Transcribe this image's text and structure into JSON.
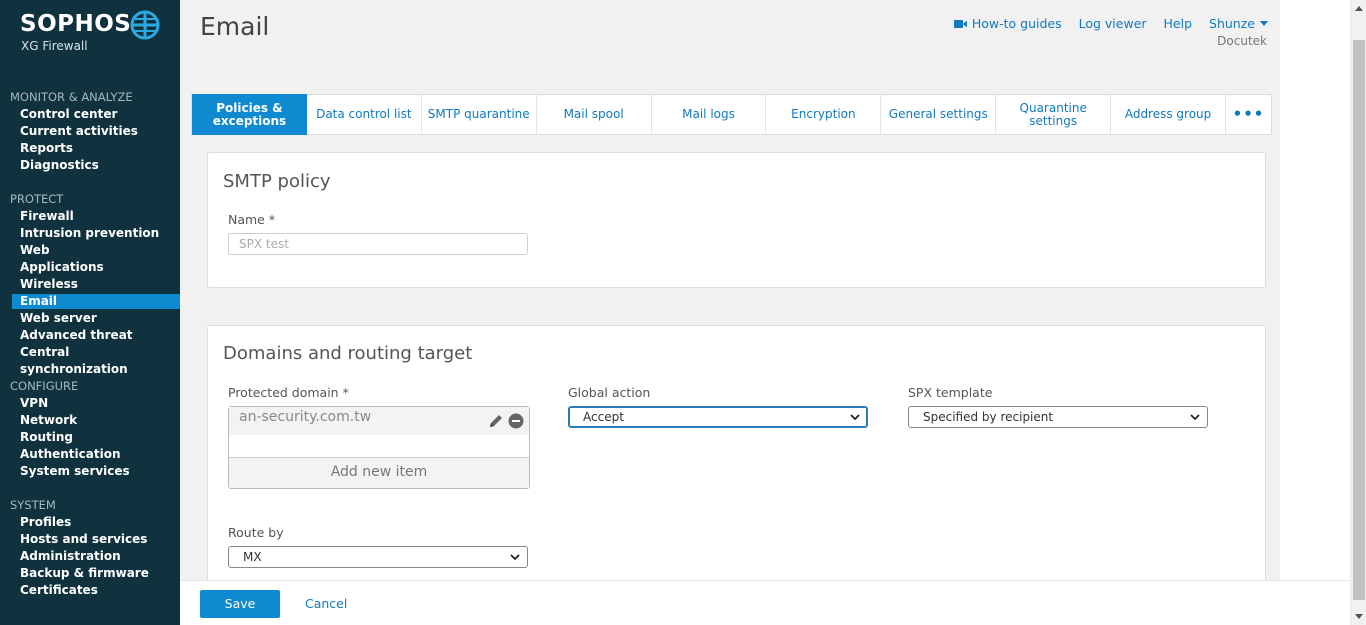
{
  "brand": {
    "name": "SOPHOS",
    "product": "XG Firewall"
  },
  "sidebar": {
    "sections": [
      {
        "heading": "MONITOR & ANALYZE",
        "items": [
          "Control center",
          "Current activities",
          "Reports",
          "Diagnostics"
        ]
      },
      {
        "heading": "PROTECT",
        "items": [
          "Firewall",
          "Intrusion prevention",
          "Web",
          "Applications",
          "Wireless",
          "Email",
          "Web server",
          "Advanced threat",
          "Central synchronization"
        ]
      },
      {
        "heading": "CONFIGURE",
        "items": [
          "VPN",
          "Network",
          "Routing",
          "Authentication",
          "System services"
        ]
      },
      {
        "heading": "SYSTEM",
        "items": [
          "Profiles",
          "Hosts and services",
          "Administration",
          "Backup & firmware",
          "Certificates"
        ]
      }
    ],
    "active_item": "Email"
  },
  "header": {
    "title": "Email",
    "links": {
      "howto": "How-to guides",
      "logviewer": "Log viewer",
      "help": "Help",
      "user": "Shunze"
    },
    "subtitle": "Docutek"
  },
  "tabs": [
    {
      "label_line1": "Policies &",
      "label_line2": "exceptions"
    },
    {
      "label_line1": "Data control list",
      "label_line2": ""
    },
    {
      "label_line1": "SMTP quarantine",
      "label_line2": ""
    },
    {
      "label_line1": "Mail spool",
      "label_line2": ""
    },
    {
      "label_line1": "Mail logs",
      "label_line2": ""
    },
    {
      "label_line1": "Encryption",
      "label_line2": ""
    },
    {
      "label_line1": "General settings",
      "label_line2": ""
    },
    {
      "label_line1": "Quarantine",
      "label_line2": "settings"
    },
    {
      "label_line1": "Address group",
      "label_line2": ""
    },
    {
      "label_line1": "•••",
      "label_line2": ""
    }
  ],
  "smtp_policy": {
    "title": "SMTP policy",
    "name_label": "Name *",
    "name_value": "SPX test"
  },
  "domains": {
    "title": "Domains and routing target",
    "protected_label": "Protected domain *",
    "protected_items": [
      "an-security.com.tw"
    ],
    "add_new": "Add new item",
    "global_action_label": "Global action",
    "global_action_value": "Accept",
    "spx_label": "SPX template",
    "spx_value": "Specified by recipient",
    "route_label": "Route by",
    "route_value": "MX"
  },
  "footer": {
    "save": "Save",
    "cancel": "Cancel"
  },
  "colors": {
    "sidebar_bg": "#10323e",
    "accent": "#0f8ad0",
    "link": "#0f7ac0"
  }
}
